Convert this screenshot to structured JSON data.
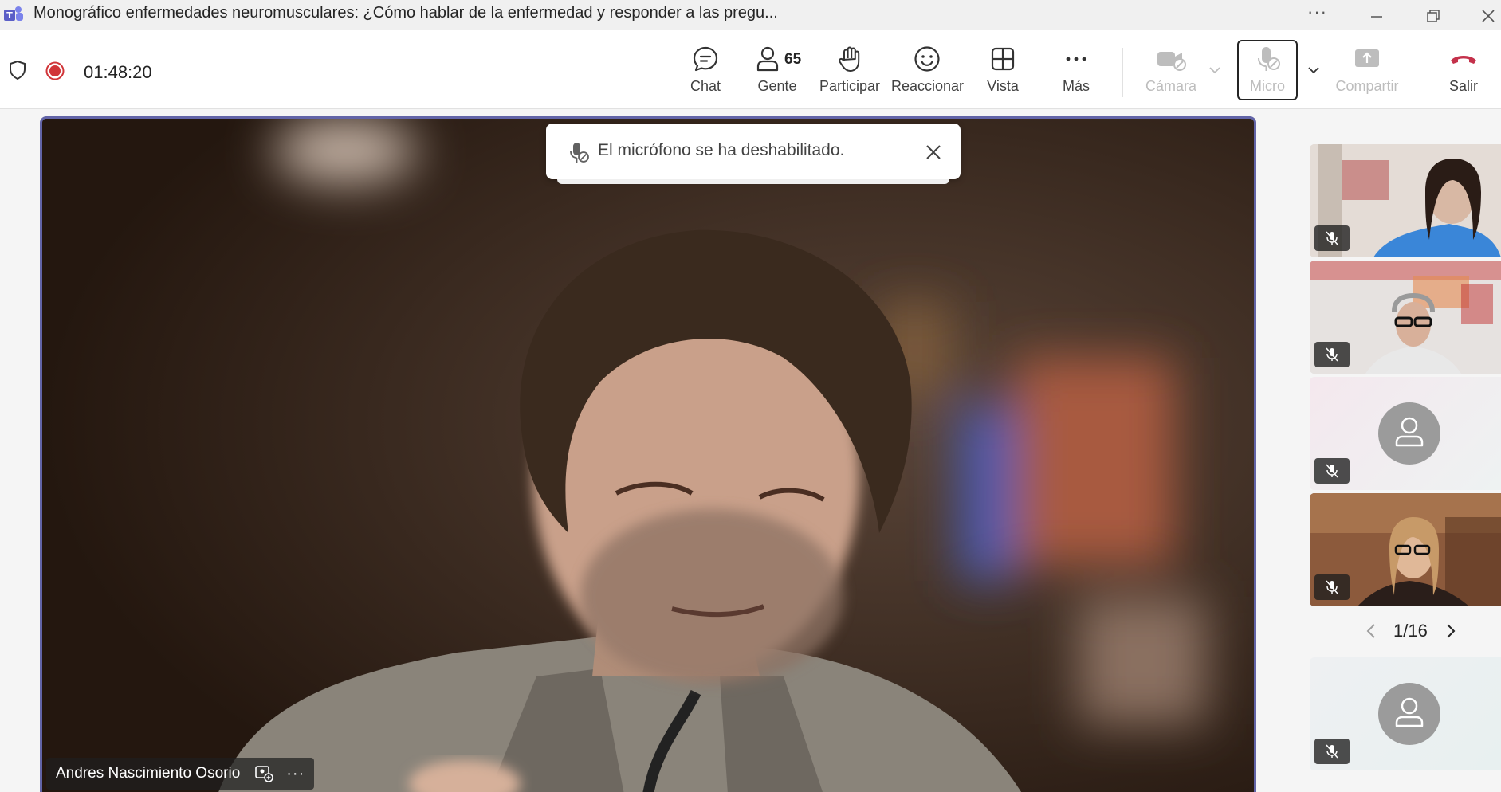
{
  "window": {
    "title": "Monográfico enfermedades neuromusculares: ¿Cómo hablar de la enfermedad y responder a las pregu...",
    "more_label": "···"
  },
  "meeting": {
    "timer": "01:48:20",
    "participant_count": "65"
  },
  "toolbar": {
    "chat": "Chat",
    "people": "Gente",
    "raise": "Participar",
    "react": "Reaccionar",
    "view": "Vista",
    "more": "Más",
    "camera": "Cámara",
    "mic": "Micro",
    "share": "Compartir",
    "leave": "Salir"
  },
  "toast": {
    "message": "El micrófono se ha deshabilitado."
  },
  "stage": {
    "speaker_name": "Andres Nascimiento Osorio",
    "more_label": "···"
  },
  "pager": {
    "label": "1/16"
  },
  "colors": {
    "accent": "#6264a7",
    "record": "#d13438",
    "leave": "#c4314b",
    "disabled": "#bdbdbd"
  }
}
